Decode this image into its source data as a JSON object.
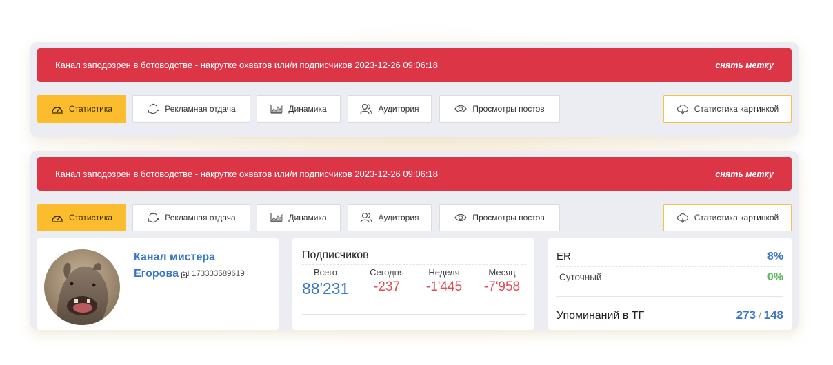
{
  "alert": {
    "text": "Канал заподозрен в ботоводстве - накрутке охватов или/и подписчиков 2023-12-26 09:06:18",
    "action": "снять метку"
  },
  "tabs": [
    {
      "label": "Статистика",
      "icon": "speedometer-icon",
      "active": true
    },
    {
      "label": "Рекламная отдача",
      "icon": "refresh-cycle-icon",
      "active": false
    },
    {
      "label": "Динамика",
      "icon": "area-chart-icon",
      "active": false
    },
    {
      "label": "Аудитория",
      "icon": "audience-icon",
      "active": false
    },
    {
      "label": "Просмотры постов",
      "icon": "eye-icon",
      "active": false
    }
  ],
  "image_stats": {
    "label": "Статистика картинкой",
    "icon": "cloud-icon"
  },
  "channel": {
    "name_line1": "Канал мистера",
    "name_line2": "Егорова",
    "id": "173333589619",
    "avatar": "rhinoceros-photo"
  },
  "subscribers": {
    "title": "Подписчиков",
    "total_label": "Всего",
    "total_value": "88'231",
    "columns": [
      {
        "label": "Сегодня",
        "value": "-237"
      },
      {
        "label": "Неделя",
        "value": "-1'445"
      },
      {
        "label": "Месяц",
        "value": "-7'958"
      }
    ]
  },
  "er": {
    "label": "ER",
    "value": "8%",
    "daily_label": "Суточный",
    "daily_value": "0%",
    "mentions_label": "Упоминаний в ТГ",
    "mentions_a": "273",
    "mentions_sep": "/",
    "mentions_b": "148"
  },
  "colors": {
    "alert": "#dc3545",
    "active_tab": "#fbbd2d",
    "link_blue": "#3b78c3",
    "negative": "#e24b55",
    "positive": "#5cb85c"
  }
}
